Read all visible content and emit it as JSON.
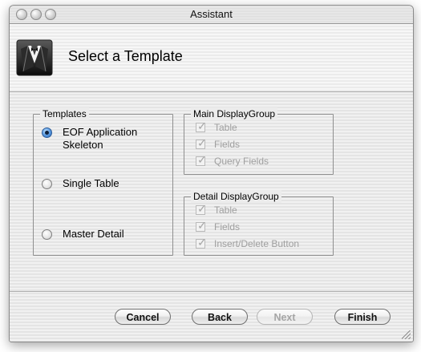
{
  "window": {
    "title": "Assistant"
  },
  "header": {
    "title": "Select a Template",
    "icon": "tuxedo-icon"
  },
  "templates": {
    "title": "Templates",
    "options": [
      {
        "label": "EOF Application\nSkeleton",
        "selected": true
      },
      {
        "label": "Single Table",
        "selected": false
      },
      {
        "label": "Master Detail",
        "selected": false
      }
    ]
  },
  "main_group": {
    "title": "Main DisplayGroup",
    "items": [
      {
        "label": "Table",
        "checked": true,
        "enabled": false
      },
      {
        "label": "Fields",
        "checked": true,
        "enabled": false
      },
      {
        "label": "Query Fields",
        "checked": true,
        "enabled": false
      }
    ]
  },
  "detail_group": {
    "title": "Detail DisplayGroup",
    "items": [
      {
        "label": "Table",
        "checked": true,
        "enabled": false
      },
      {
        "label": "Fields",
        "checked": true,
        "enabled": false
      },
      {
        "label": "Insert/Delete Button",
        "checked": true,
        "enabled": false
      }
    ]
  },
  "buttons": {
    "cancel": "Cancel",
    "back": "Back",
    "next": "Next",
    "finish": "Finish"
  },
  "colors": {
    "accent": "#3a78c8",
    "disabled_text": "#9f9f9f"
  }
}
